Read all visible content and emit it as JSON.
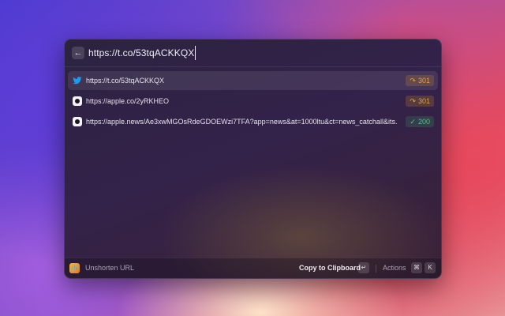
{
  "search": {
    "back_icon": "arrow-left-icon",
    "value": "https://t.co/53tqACKKQX"
  },
  "results": [
    {
      "icon": "twitter-bird-icon",
      "url": "https://t.co/53tqACKKQX",
      "status_icon": "redirect-icon",
      "status": "301",
      "selected": true
    },
    {
      "icon": "apple-icon",
      "url": "https://apple.co/2yRKHEO",
      "status_icon": "redirect-icon",
      "status": "301",
      "selected": false
    },
    {
      "icon": "apple-icon",
      "url": "https://apple.news/Ae3xwMGOsRdeGDOEWzi7TFA?app=news&at=1000ltu&ct=news_catchall&its...",
      "status_icon": "check-circle-icon",
      "status": "200",
      "selected": false
    }
  ],
  "footer": {
    "extension_icon": "link-icon",
    "extension_name": "Unshorten URL",
    "primary_action": "Copy to Clipboard",
    "primary_key": "↵",
    "actions_label": "Actions",
    "actions_keys": [
      "⌘",
      "K"
    ]
  },
  "colors": {
    "redirect": "#e3a437",
    "ok": "#55c37b",
    "twitter": "#1d9bf0"
  }
}
